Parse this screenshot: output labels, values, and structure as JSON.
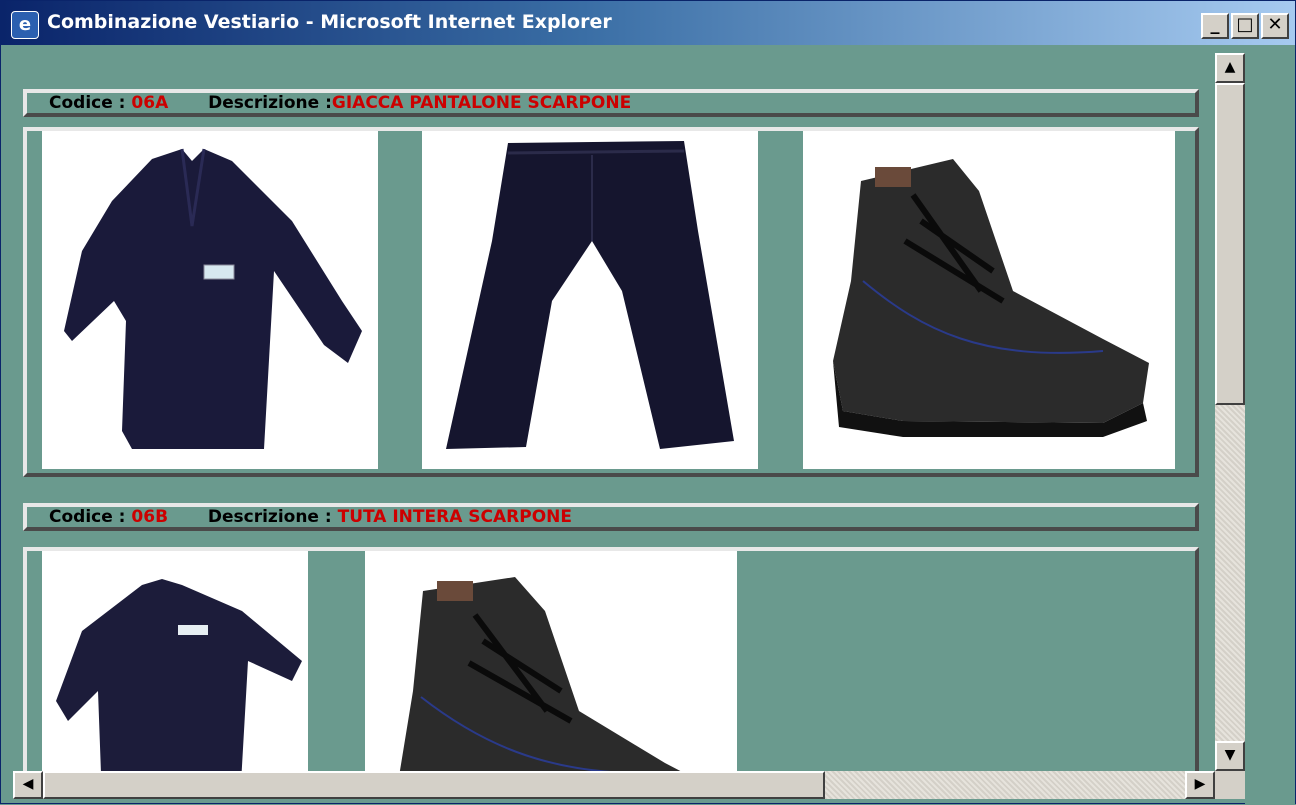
{
  "window": {
    "title": "Combinazione Vestiario - Microsoft Internet Explorer",
    "buttons": {
      "minimize": "_",
      "maximize": "□",
      "close": "✕"
    }
  },
  "sections": [
    {
      "code_label": "Codice :",
      "code_value": "06A",
      "desc_label": "Descrizione :",
      "desc_value": "GIACCA PANTALONE SCARPONE",
      "items": [
        "jacket",
        "trousers",
        "boot"
      ]
    },
    {
      "code_label": "Codice :",
      "code_value": "06B",
      "desc_label": "Descrizione :",
      "desc_value": "TUTA INTERA SCARPONE",
      "items": [
        "coverall",
        "boot"
      ]
    }
  ],
  "colors": {
    "background": "#6a9a8e",
    "code_text": "#cc0000",
    "title_bar_start": "#0a246a",
    "title_bar_end": "#a6caf0"
  }
}
